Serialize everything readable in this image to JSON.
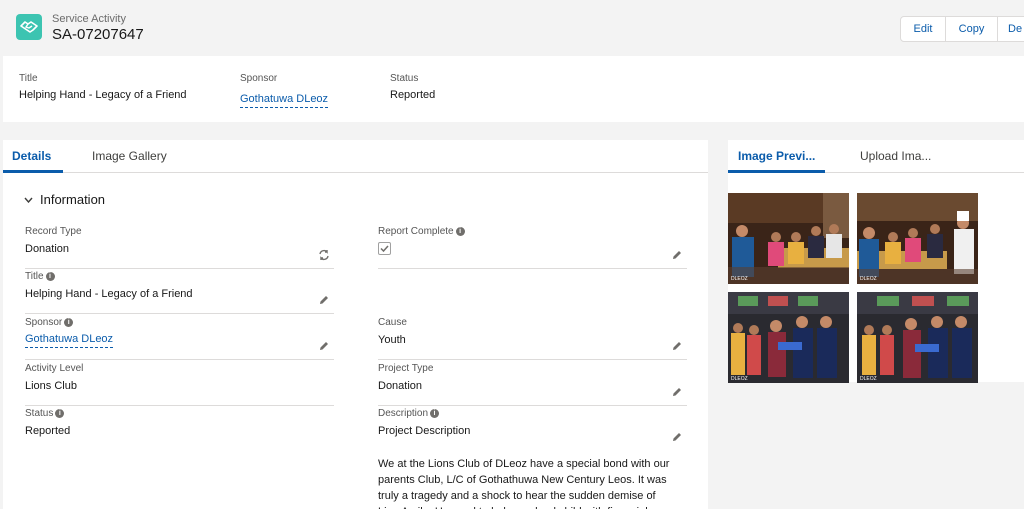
{
  "header": {
    "object_label": "Service Activity",
    "record_name": "SA-07207647",
    "buttons": {
      "edit": "Edit",
      "copy": "Copy",
      "delete": "De"
    }
  },
  "highlights": [
    {
      "label": "Title",
      "value": "Helping Hand - Legacy of a Friend",
      "is_link": false
    },
    {
      "label": "Sponsor",
      "value": "Gothatuwa DLeoz",
      "is_link": true
    },
    {
      "label": "Status",
      "value": "Reported",
      "is_link": false
    }
  ],
  "tabs": {
    "details": "Details",
    "gallery": "Image Gallery"
  },
  "section": {
    "title": "Information"
  },
  "fields": {
    "record_type": {
      "label": "Record Type",
      "value": "Donation"
    },
    "report_complete": {
      "label": "Report Complete",
      "checked": true
    },
    "title": {
      "label": "Title",
      "value": "Helping Hand - Legacy of a Friend"
    },
    "sponsor": {
      "label": "Sponsor",
      "value": "Gothatuwa DLeoz"
    },
    "cause": {
      "label": "Cause",
      "value": "Youth"
    },
    "activity_level": {
      "label": "Activity Level",
      "value": "Lions Club"
    },
    "project_type": {
      "label": "Project Type",
      "value": "Donation"
    },
    "status": {
      "label": "Status",
      "value": "Reported"
    },
    "description": {
      "label": "Description",
      "value": "Project Description",
      "body": "We at the Lions Club of DLeoz have a special bond with our parents Club, L/C of Gothathuwa New Century Leos. It was truly a tragedy and a shock to hear the sudden demise of Lion Amila. He used to help a school child with financial"
    }
  },
  "right_tabs": {
    "preview": "Image Previ...",
    "upload": "Upload Ima..."
  },
  "images": [
    {
      "name": "food-service-photo-1",
      "watermark": "DLEOZ"
    },
    {
      "name": "food-service-photo-2",
      "watermark": "DLEOZ"
    },
    {
      "name": "donation-ceremony-photo-1",
      "watermark": "DLEOZ"
    },
    {
      "name": "donation-ceremony-photo-2",
      "watermark": "DLEOZ"
    }
  ],
  "colors": {
    "brand": "#0b5cab",
    "record_icon": "#3cc4b1"
  }
}
